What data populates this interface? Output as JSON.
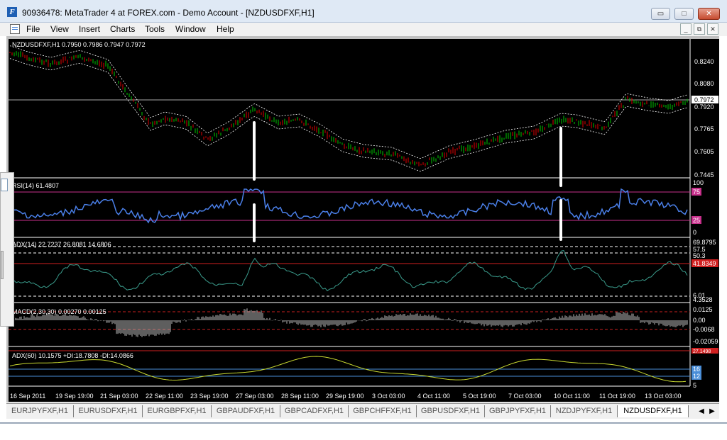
{
  "window": {
    "title": "90936478: MetaTrader 4 at FOREX.com - Demo Account - [NZDUSDFXF,H1]",
    "app_icon": "F",
    "minimize": "▭",
    "maximize": "□",
    "close": "✕"
  },
  "menu": {
    "items": [
      "File",
      "View",
      "Insert",
      "Charts",
      "Tools",
      "Window",
      "Help"
    ],
    "mdi_minimize": "_",
    "mdi_restore": "⧉",
    "mdi_close": "✕"
  },
  "chart": {
    "symbol_header": "NZDUSDFXF,H1  0.7950 0.7986 0.7947 0.7972",
    "price_labels": [
      "0.8240",
      "0.8080",
      "0.7920",
      "0.7765",
      "0.7605",
      "0.7445"
    ],
    "current_price": "0.7972",
    "rsi": {
      "header": "RSI(14) 61.4807",
      "scale": [
        "100",
        "0"
      ],
      "levels": [
        "75",
        "25"
      ]
    },
    "adx14": {
      "header": "ADX(14) 22.7237 26.8081 14.6806",
      "scale_top": "69.8795",
      "levels": [
        "57.5",
        "50.3"
      ],
      "current": "41.8349",
      "scale_bottom": [
        "6.01",
        "4.3528"
      ]
    },
    "macd": {
      "header": "MACD(2,30,30) 0.00270 0.00125",
      "scale": [
        "0.0125",
        "0.00",
        "-0.0068",
        "-0.02059"
      ]
    },
    "adx60": {
      "header": "ADX(60) 10.1575 +DI:18.7808 -DI:14.0866",
      "scale": [
        "16",
        "12",
        "5"
      ],
      "top_value": "27.1498"
    },
    "time_labels": [
      "16 Sep 2011",
      "19 Sep 19:00",
      "21 Sep 03:00",
      "22 Sep 11:00",
      "23 Sep 19:00",
      "27 Sep 03:00",
      "28 Sep 11:00",
      "29 Sep 19:00",
      "3 Oct 03:00",
      "4 Oct 11:00",
      "5 Oct 19:00",
      "7 Oct 03:00",
      "10 Oct 11:00",
      "11 Oct 19:00",
      "13 Oct 03:00"
    ],
    "colors": {
      "background": "#000000",
      "bull_candle": "#00c800",
      "bear_candle": "#e00000",
      "rsi_line": "#4a7fe8",
      "adx_line": "#3a9c8c",
      "adx60_line": "#c8d830",
      "level_line": "#c8308c",
      "grid_text": "#ffffff"
    }
  },
  "tabs": {
    "items": [
      "EURJPYFXF,H1",
      "EURUSDFXF,H1",
      "EURGBPFXF,H1",
      "GBPAUDFXF,H1",
      "GBPCADFXF,H1",
      "GBPCHFFXF,H1",
      "GBPUSDFXF,H1",
      "GBPJPYFXF,H1",
      "NZDJPYFXF,H1",
      "NZDUSDFXF,H1"
    ],
    "nav_left": "◀",
    "nav_right": "▶"
  }
}
